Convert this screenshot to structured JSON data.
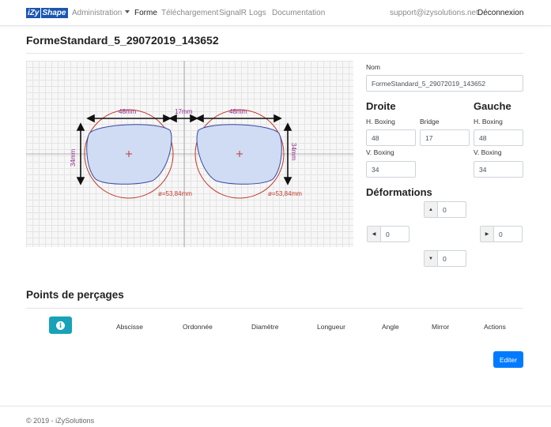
{
  "navbar": {
    "brand_left": "iZy",
    "brand_right": "Shape",
    "admin": "Administration",
    "forme": "Forme",
    "telechargement": "Téléchargement",
    "signalr": "SignalR",
    "logs": "Logs",
    "documentation": "Documentation",
    "email": "support@izysolutions.net",
    "logout": "Déconnexion"
  },
  "page_title": "FormeStandard_5_29072019_143652",
  "drawing": {
    "left_width": "48mm",
    "bridge": "17mm",
    "right_width": "48mm",
    "left_height": "34mm",
    "right_height": "34mm",
    "left_diameter": "ø=53,84mm",
    "right_diameter": "ø=53,84mm"
  },
  "form": {
    "nom_label": "Nom",
    "nom_value": "FormeStandard_5_29072019_143652",
    "droite": "Droite",
    "gauche": "Gauche",
    "droite_hboxing_label": "H. Boxing",
    "droite_hboxing_value": "48",
    "bridge_label": "Bridge",
    "bridge_value": "17",
    "gauche_hboxing_label": "H. Boxing",
    "gauche_hboxing_value": "48",
    "droite_vboxing_label": "V. Boxing",
    "droite_vboxing_value": "34",
    "gauche_vboxing_label": "V. Boxing",
    "gauche_vboxing_value": "34"
  },
  "deformations": {
    "title": "Déformations",
    "up": "0",
    "left": "0",
    "right": "0",
    "down": "0"
  },
  "points": {
    "title": "Points de perçages",
    "info_icon": "i",
    "columns": [
      "Abscisse",
      "Ordonnée",
      "Diamètre",
      "Longueur",
      "Angle",
      "Mirror",
      "Actions"
    ],
    "edit": "Editer"
  },
  "footer": "© 2019 - iZySolutions",
  "colors": {
    "brand": "#1a56b0",
    "info": "#17a2b8",
    "primary": "#007bff",
    "circle": "#c0392b",
    "lens_fill": "#cfdcf4",
    "lens_stroke": "#3a4a9c",
    "dimension_text": "#8e2a8e"
  }
}
